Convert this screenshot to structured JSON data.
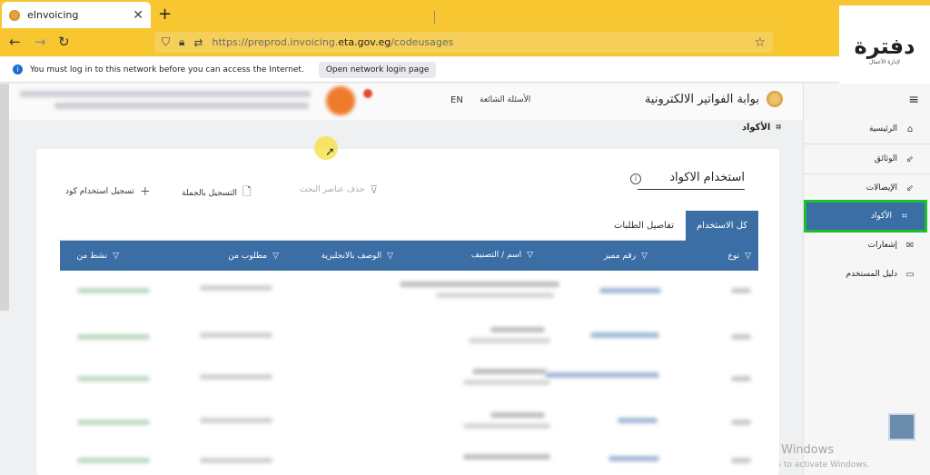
{
  "browser": {
    "tab_title": "eInvoicing",
    "tab_close": "✕",
    "new_tab": "+",
    "back": "←",
    "forward": "→",
    "reload": "↻",
    "url_prefix": "https://preprod.invoicing.",
    "url_domain": "eta.gov.eg",
    "url_path": "/codeusages",
    "bookmark": "☆"
  },
  "notice": {
    "message": "You must log in to this network before you can access the Internet.",
    "button": "Open network login page"
  },
  "logo": {
    "title": "دفترة",
    "subtitle": "لإدارة الأعمال"
  },
  "header": {
    "brand": "بوابة الفواتير الالكترونية",
    "faq": "الأسئلة الشائعة",
    "lang": "EN"
  },
  "breadcrumb": {
    "label": "الأكواد"
  },
  "sidebar": {
    "items": [
      {
        "label": "الرئيسية",
        "icon": "⌂"
      },
      {
        "label": "الوثائق",
        "icon": "⇙"
      },
      {
        "label": "الإيصالات",
        "icon": "⇙"
      },
      {
        "label": "الأكواد",
        "icon": "⌗"
      },
      {
        "label": "إشعارات",
        "icon": "✉"
      },
      {
        "label": "دليل المستخدم",
        "icon": "▭"
      }
    ]
  },
  "card": {
    "title": "استخدام الاكواد",
    "actions": {
      "clear_filters": "حذف عناصر البحث",
      "bulk_register": "التسجيل بالجملة",
      "register_code": "تسجيل استخدام كود"
    },
    "tabs": {
      "all": "كل الاستخدام",
      "requests": "تفاصيل الطلبات"
    },
    "columns": [
      "نوع",
      "رقم مميز",
      "اسم / التصنيف",
      "الوصف بالانجليزية",
      "مطلوب من",
      "نشط من"
    ]
  },
  "windows": {
    "title": "e Windows",
    "subtitle": "ngs to activate Windows."
  },
  "colors": {
    "chrome": "#f7c631",
    "primary": "#3a6ea5",
    "highlight": "#1bc02b"
  }
}
